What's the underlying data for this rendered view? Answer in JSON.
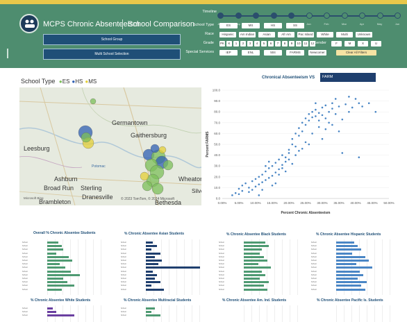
{
  "header": {
    "title": "MCPS Chronic Absenteeism",
    "subtitle": "School Comparison",
    "school_group_label": "School Group",
    "multi_school_label": "Multi School Selection",
    "timeline_label": "Timeline",
    "timeline_months": [
      "Aug",
      "Sep",
      "Oct",
      "Nov",
      "Dec",
      "Jan",
      "Feb",
      "Mar",
      "Apr",
      "May",
      "Jun"
    ],
    "timeline_active_count": 5,
    "school_type_label": "School Type",
    "school_type_options": [
      "ES",
      "MS",
      "HS",
      "SS"
    ],
    "race_label": "Race",
    "race_options": [
      "Hispanic",
      "Am Indian",
      "Asian",
      "Afr Am",
      "Pac Island",
      "White",
      "Multi",
      "Unknown"
    ],
    "grade_label": "Grade",
    "grade_options": [
      "PK",
      "K",
      "1",
      "2",
      "3",
      "4",
      "5",
      "6",
      "7",
      "8",
      "9",
      "10",
      "11",
      "12"
    ],
    "gender_label": "Gender",
    "gender_options": [
      "F",
      "M",
      "X",
      "U"
    ],
    "special_label": "Special Services",
    "special_options": [
      "IEP",
      "ENL",
      "504",
      "FARMS",
      "Newcomer"
    ],
    "clear_label": "Clear All Filters"
  },
  "map": {
    "title_prefix": "School Type",
    "legend": [
      {
        "label": "ES",
        "color": "#7cbf5a"
      },
      {
        "label": "HS",
        "color": "#2f5fb3"
      },
      {
        "label": "MS",
        "color": "#e3cf37"
      }
    ],
    "labels": [
      "Germantown",
      "Gaithersburg",
      "Leesburg",
      "Ashburn",
      "Broad Run",
      "Sterling",
      "Brambleton",
      "Dranesville",
      "Potomac",
      "Wheaton",
      "Bethesda",
      "Silver"
    ],
    "attribution": "© 2023 TomTom, © 2024 Microsoft",
    "brand": "Microsoft Bing"
  },
  "chart_data": [
    {
      "type": "scatter",
      "title": "Chronical Absenteeism VS",
      "title_box": "FARM",
      "xlabel": "Percent Chronic Absenteeism",
      "ylabel": "Percent FARMS",
      "xlim": [
        0,
        50
      ],
      "ylim": [
        0,
        100
      ],
      "xticks": [
        "0.00%",
        "5.00%",
        "10.00%",
        "15.00%",
        "20.00%",
        "25.00%",
        "30.00%",
        "35.00%",
        "40.00%",
        "45.00%",
        "50.00%"
      ],
      "yticks": [
        "0.0",
        "10.0",
        "20.0",
        "30.0",
        "40.0",
        "50.0",
        "60.0",
        "70.0",
        "80.0",
        "90.0",
        "100.0"
      ],
      "color": "#4a86c5",
      "points": [
        [
          3,
          3
        ],
        [
          4,
          5
        ],
        [
          5,
          4
        ],
        [
          6,
          7
        ],
        [
          5,
          9
        ],
        [
          6,
          12
        ],
        [
          7,
          14
        ],
        [
          8,
          10
        ],
        [
          8,
          6
        ],
        [
          9,
          16
        ],
        [
          9,
          8
        ],
        [
          10,
          11
        ],
        [
          10,
          18
        ],
        [
          11,
          20
        ],
        [
          11,
          13
        ],
        [
          12,
          15
        ],
        [
          12,
          22
        ],
        [
          13,
          17
        ],
        [
          13,
          25
        ],
        [
          14,
          19
        ],
        [
          14,
          28
        ],
        [
          15,
          21
        ],
        [
          15,
          30
        ],
        [
          16,
          24
        ],
        [
          16,
          33
        ],
        [
          17,
          27
        ],
        [
          17,
          36
        ],
        [
          18,
          31
        ],
        [
          18,
          40
        ],
        [
          19,
          34
        ],
        [
          19,
          38
        ],
        [
          20,
          42
        ],
        [
          20,
          45
        ],
        [
          21,
          50
        ],
        [
          21,
          55
        ],
        [
          22,
          48
        ],
        [
          22,
          60
        ],
        [
          23,
          58
        ],
        [
          23,
          65
        ],
        [
          24,
          62
        ],
        [
          24,
          70
        ],
        [
          25,
          68
        ],
        [
          25,
          74
        ],
        [
          26,
          72
        ],
        [
          26,
          78
        ],
        [
          27,
          75
        ],
        [
          27,
          80
        ],
        [
          28,
          76
        ],
        [
          28,
          82
        ],
        [
          29,
          79
        ],
        [
          29,
          72
        ],
        [
          30,
          84
        ],
        [
          30,
          77
        ],
        [
          31,
          74
        ],
        [
          31,
          86
        ],
        [
          32,
          80
        ],
        [
          32,
          70
        ],
        [
          33,
          83
        ],
        [
          33,
          88
        ],
        [
          34,
          78
        ],
        [
          35,
          85
        ],
        [
          36,
          73
        ],
        [
          37,
          87
        ],
        [
          38,
          80
        ],
        [
          39,
          84
        ],
        [
          40,
          92
        ],
        [
          41,
          88
        ],
        [
          42,
          85
        ],
        [
          44,
          88
        ],
        [
          46,
          80
        ],
        [
          35,
          62
        ],
        [
          30,
          55
        ],
        [
          26,
          50
        ],
        [
          24,
          46
        ],
        [
          22,
          40
        ],
        [
          20,
          36
        ],
        [
          18,
          28
        ],
        [
          16,
          14
        ],
        [
          14,
          34
        ],
        [
          12,
          8
        ],
        [
          11,
          3
        ],
        [
          13,
          30
        ],
        [
          15,
          12
        ],
        [
          17,
          22
        ],
        [
          19,
          25
        ],
        [
          21,
          32
        ],
        [
          23,
          44
        ],
        [
          25,
          52
        ],
        [
          27,
          60
        ],
        [
          29,
          66
        ],
        [
          31,
          64
        ],
        [
          33,
          68
        ],
        [
          36,
          42
        ],
        [
          41,
          38
        ],
        [
          28,
          88
        ],
        [
          38,
          94
        ],
        [
          34,
          92
        ]
      ]
    }
  ],
  "mini_charts": [
    {
      "title": "Overall % Chronic Absentee Students",
      "color": "#4e9a72",
      "values": [
        6,
        8,
        9,
        5,
        12,
        14,
        7,
        10,
        13,
        18,
        9,
        11,
        15,
        8
      ]
    },
    {
      "title": "% Chronic Absentee Asian Students",
      "color": "#1f3f6e",
      "values": [
        4,
        6,
        3,
        8,
        5,
        9,
        7,
        30,
        4,
        6,
        5,
        8,
        3,
        10
      ]
    },
    {
      "title": "% Chronic Absentee Black Students",
      "color": "#4e9a72",
      "values": [
        12,
        14,
        10,
        9,
        11,
        13,
        8,
        15,
        10,
        12,
        9,
        14,
        11,
        13
      ]
    },
    {
      "title": "% Chronic Absentee Hispanic Students",
      "color": "#4a86c5",
      "values": [
        10,
        12,
        14,
        9,
        16,
        18,
        11,
        20,
        13,
        15,
        12,
        17,
        14,
        16
      ]
    },
    {
      "title": "% Chronic Absentee White Students",
      "color": "#6a3fa0",
      "values": [
        3,
        5,
        15
      ]
    },
    {
      "title": "% Chronic Absentee Multiracial Students",
      "color": "#4e9a72",
      "values": [
        5,
        3,
        8
      ]
    },
    {
      "title": "% Chronic Absentee Am. Ind. Students",
      "color": "#4a86c5",
      "values": []
    },
    {
      "title": "% Chronic Absentee Pacific Is. Students",
      "color": "#4a86c5",
      "values": []
    }
  ]
}
